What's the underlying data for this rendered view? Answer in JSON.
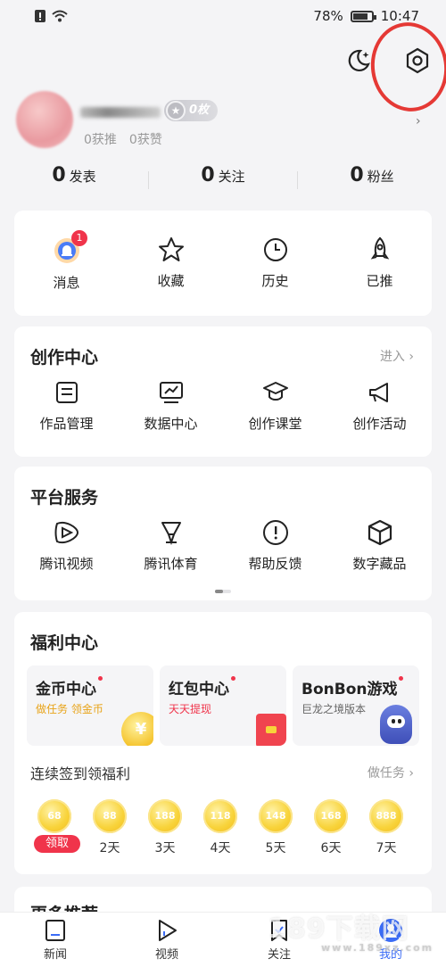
{
  "status": {
    "battery": "78%",
    "time": "10:47",
    "battery_level": 0.78
  },
  "profile": {
    "coin_badge": "0枚",
    "recommended": "0获推",
    "likes": "0获赞"
  },
  "counters": [
    {
      "num": "0",
      "label": "发表"
    },
    {
      "num": "0",
      "label": "关注"
    },
    {
      "num": "0",
      "label": "粉丝"
    }
  ],
  "quick": [
    {
      "label": "消息",
      "badge": "1"
    },
    {
      "label": "收藏"
    },
    {
      "label": "历史"
    },
    {
      "label": "已推"
    }
  ],
  "creation": {
    "title": "创作中心",
    "enter": "进入",
    "items": [
      "作品管理",
      "数据中心",
      "创作课堂",
      "创作活动"
    ]
  },
  "platform": {
    "title": "平台服务",
    "items": [
      "腾讯视频",
      "腾讯体育",
      "帮助反馈",
      "数字藏品"
    ]
  },
  "welfare": {
    "title": "福利中心",
    "cards": [
      {
        "title": "金币中心",
        "sub": "做任务 领金币",
        "sub_color": "#e8a317"
      },
      {
        "title": "红包中心",
        "sub": "天天提现",
        "sub_color": "#f0344b"
      },
      {
        "title": "BonBon游戏",
        "sub": "巨龙之境版本",
        "sub_color": "#666666"
      }
    ],
    "sign_title": "连续签到领福利",
    "sign_link": "做任务",
    "days": [
      {
        "coins": "68",
        "label": "领取"
      },
      {
        "coins": "88",
        "label": "2天"
      },
      {
        "coins": "188",
        "label": "3天"
      },
      {
        "coins": "118",
        "label": "4天"
      },
      {
        "coins": "148",
        "label": "5天"
      },
      {
        "coins": "168",
        "label": "6天"
      },
      {
        "coins": "888",
        "label": "7天"
      }
    ]
  },
  "more_title": "更多推荐",
  "tabs": [
    {
      "label": "新闻"
    },
    {
      "label": "视频"
    },
    {
      "label": "关注"
    },
    {
      "label": "我的"
    }
  ],
  "watermark": {
    "main": "189下载网",
    "sub": "www.189xz.com"
  },
  "colors": {
    "accent_red": "#f0344b",
    "coin_gold": "#f8d33a",
    "annotation_ring": "#e53935"
  }
}
